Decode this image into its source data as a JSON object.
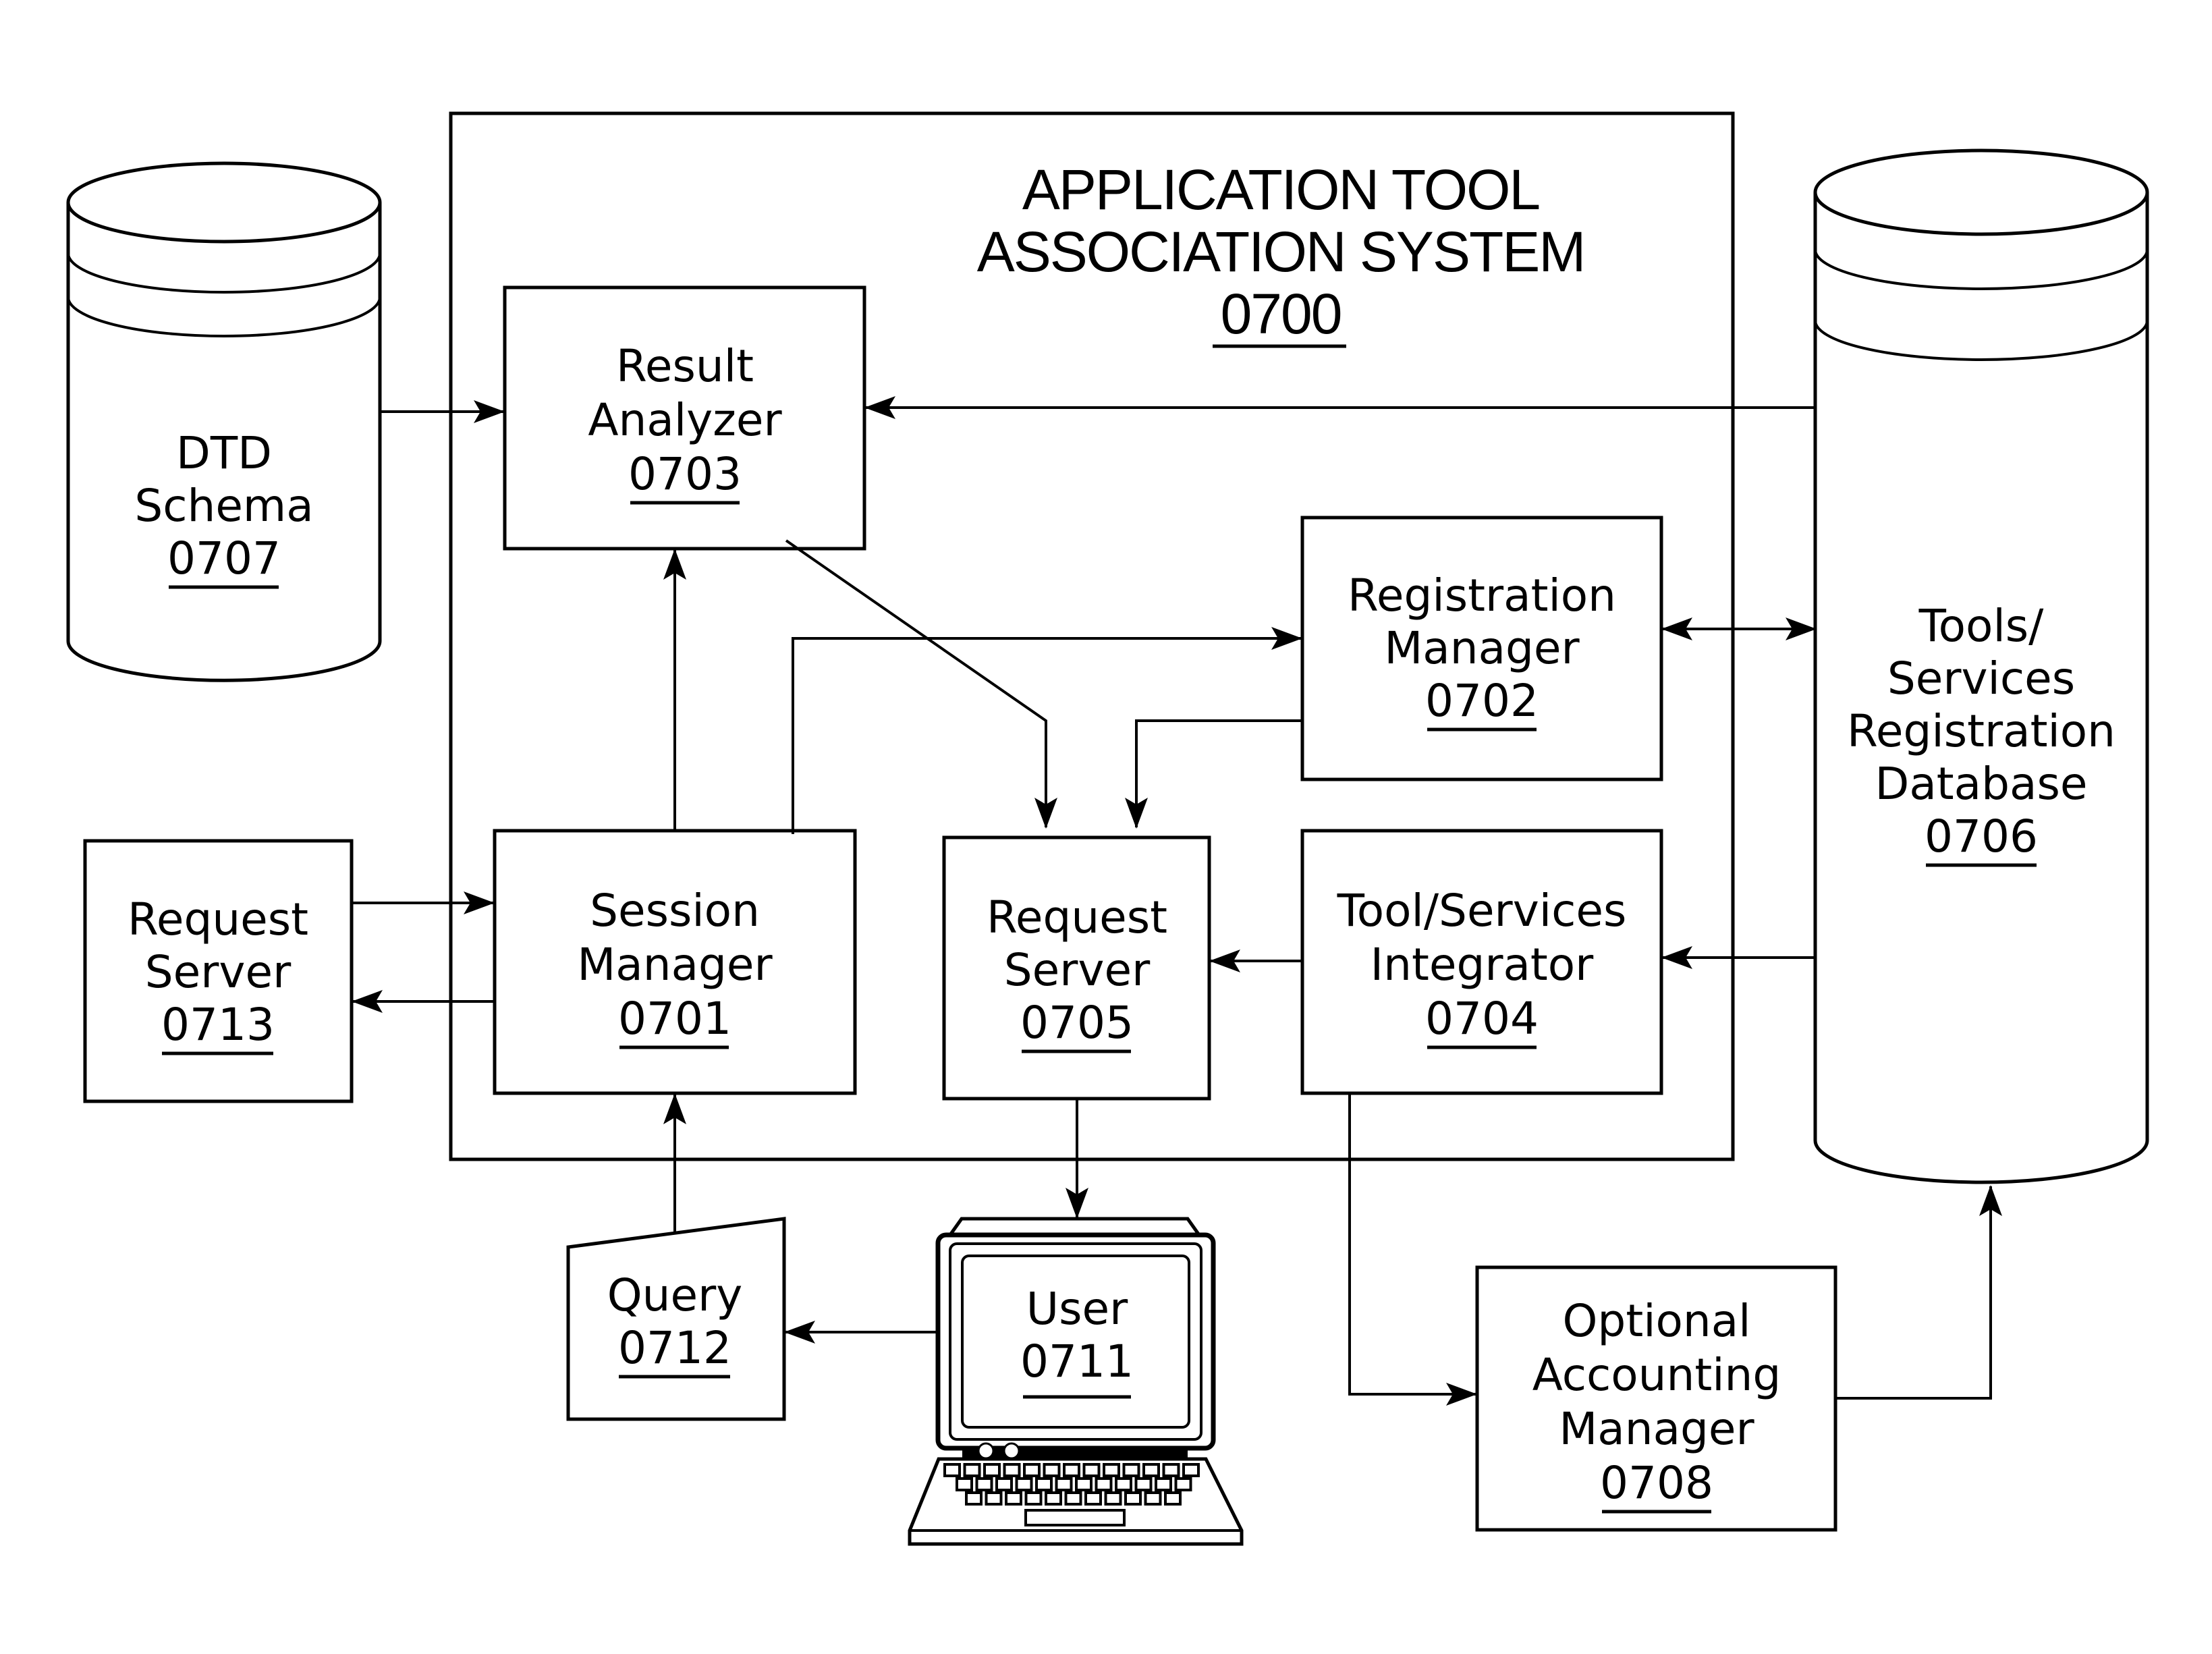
{
  "diagram": {
    "title_lines": [
      "APPLICATION TOOL",
      "ASSOCIATION SYSTEM"
    ],
    "title_ref": "0700",
    "colors": {
      "stroke": "#000000",
      "background": "#ffffff"
    },
    "nodes": {
      "session_manager": {
        "lines": [
          "Session",
          "Manager"
        ],
        "ref": "0701",
        "shape": "box"
      },
      "registration_manager": {
        "lines": [
          "Registration",
          "Manager"
        ],
        "ref": "0702",
        "shape": "box"
      },
      "result_analyzer": {
        "lines": [
          "Result",
          "Analyzer"
        ],
        "ref": "0703",
        "shape": "box"
      },
      "tool_services_integrator": {
        "lines": [
          "Tool/Services",
          "Integrator"
        ],
        "ref": "0704",
        "shape": "box"
      },
      "request_server_inner": {
        "lines": [
          "Request",
          "Server"
        ],
        "ref": "0705",
        "shape": "box"
      },
      "tools_db": {
        "lines": [
          "Tools/",
          "Services",
          "Registration",
          "Database"
        ],
        "ref": "0706",
        "shape": "database-cylinder"
      },
      "dtd_schema": {
        "lines": [
          "DTD",
          "Schema"
        ],
        "ref": "0707",
        "shape": "database-cylinder"
      },
      "accounting_manager": {
        "lines": [
          "Optional",
          "Accounting",
          "Manager"
        ],
        "ref": "0708",
        "shape": "box"
      },
      "user": {
        "lines": [
          "User"
        ],
        "ref": "0711",
        "shape": "computer-terminal"
      },
      "query": {
        "lines": [
          "Query"
        ],
        "ref": "0712",
        "shape": "manual-input"
      },
      "request_server_outer": {
        "lines": [
          "Request",
          "Server"
        ],
        "ref": "0713",
        "shape": "box"
      }
    },
    "edges": [
      {
        "from": "0707",
        "to": "0703",
        "direction": "forward"
      },
      {
        "from": "0706",
        "to": "0703",
        "direction": "forward"
      },
      {
        "from": "0701",
        "to": "0703",
        "direction": "forward"
      },
      {
        "from": "0703",
        "to": "0705",
        "direction": "forward"
      },
      {
        "from": "0701",
        "to": "0702",
        "direction": "forward"
      },
      {
        "from": "0702",
        "to": "0705",
        "direction": "forward"
      },
      {
        "from": "0702",
        "to": "0706",
        "direction": "bidirectional"
      },
      {
        "from": "0706",
        "to": "0704",
        "direction": "forward"
      },
      {
        "from": "0704",
        "to": "0705",
        "direction": "forward"
      },
      {
        "from": "0713",
        "to": "0701",
        "direction": "forward"
      },
      {
        "from": "0701",
        "to": "0713",
        "direction": "forward"
      },
      {
        "from": "0712",
        "to": "0701",
        "direction": "forward"
      },
      {
        "from": "0711",
        "to": "0712",
        "direction": "forward"
      },
      {
        "from": "0705",
        "to": "0711",
        "direction": "forward"
      },
      {
        "from": "0704",
        "to": "0708",
        "direction": "forward"
      },
      {
        "from": "0708",
        "to": "0706",
        "direction": "forward"
      }
    ]
  }
}
